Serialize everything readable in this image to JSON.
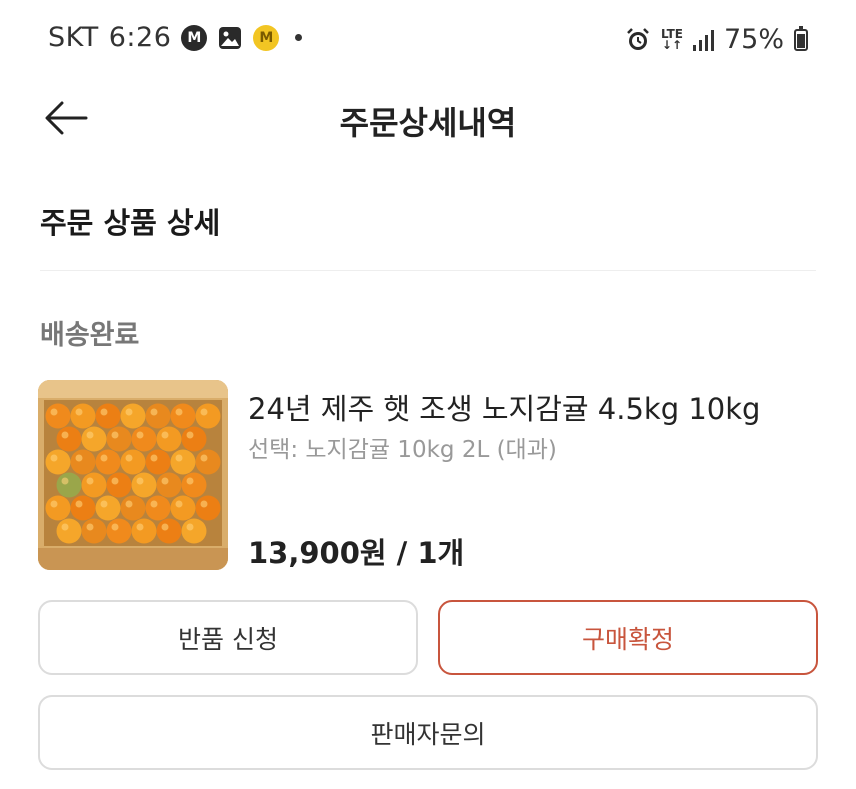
{
  "status_bar": {
    "carrier": "SKT",
    "time": "6:26",
    "network": "LTE",
    "battery": "75%",
    "icons": [
      "m-app-icon",
      "gallery-icon",
      "m-coin-icon",
      "notification-dot",
      "alarm-icon",
      "lte-icon",
      "signal-icon",
      "battery-icon"
    ]
  },
  "header": {
    "back_icon": "arrow-left-icon",
    "title": "주문상세내역"
  },
  "section": {
    "title": "주문 상품 상세"
  },
  "order": {
    "status": "배송완료",
    "product": {
      "image": "mandarin-box-photo",
      "name": "24년 제주 햇 조생 노지감귤 4.5kg 10kg",
      "option": "선택: 노지감귤 10kg 2L (대과)",
      "price": "13,900원 / 1개"
    }
  },
  "buttons": {
    "return_label": "반품 신청",
    "confirm_label": "구매확정",
    "inquiry_label": "판매자문의"
  },
  "colors": {
    "accent": "#c8553d",
    "status_text": "#777777",
    "option_text": "#999999",
    "border": "#dcdcdc"
  }
}
